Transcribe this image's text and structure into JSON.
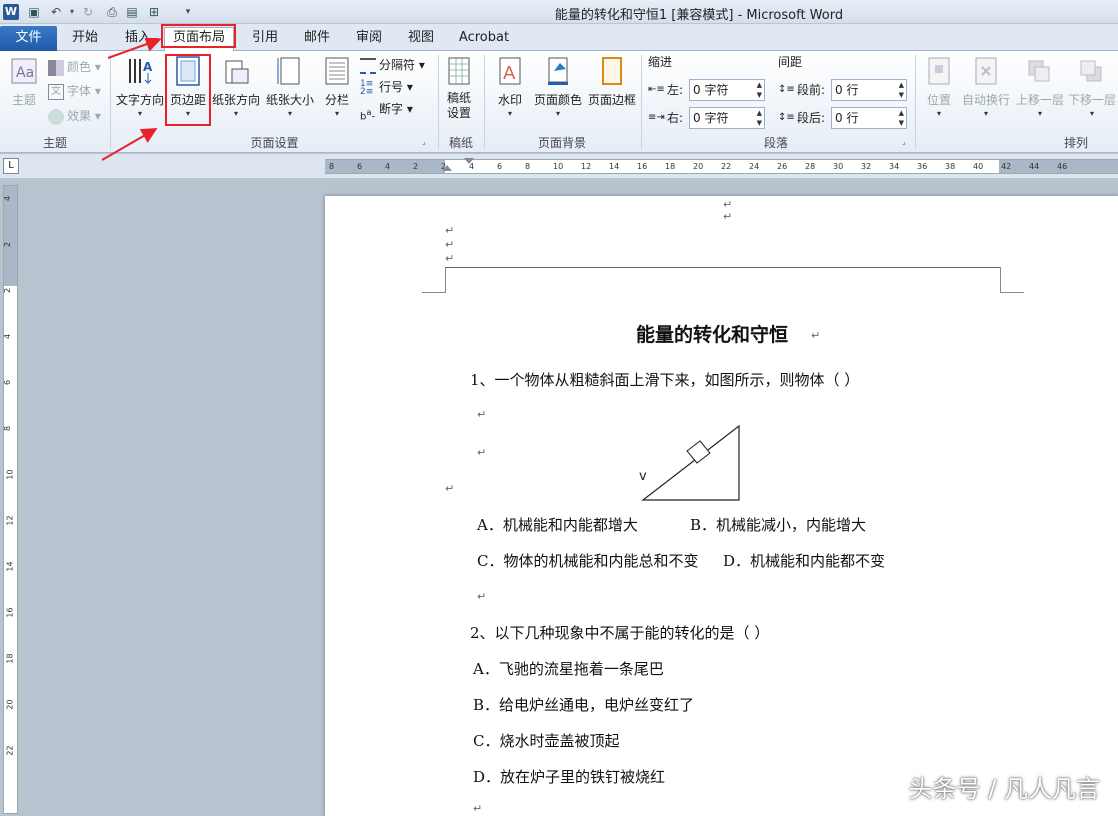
{
  "title_bar": {
    "title": "能量的转化和守恒1 [兼容模式]  -  Microsoft Word"
  },
  "tabs": [
    {
      "label": "文件"
    },
    {
      "label": "开始"
    },
    {
      "label": "插入"
    },
    {
      "label": "页面布局"
    },
    {
      "label": "引用"
    },
    {
      "label": "邮件"
    },
    {
      "label": "审阅"
    },
    {
      "label": "视图"
    },
    {
      "label": "Acrobat"
    }
  ],
  "ribbon": {
    "theme": {
      "big": "主题",
      "colors": "颜色",
      "fonts": "字体",
      "effects": "效果",
      "group": "主题"
    },
    "page_setup": {
      "text_direction": "文字方向",
      "margins": "页边距",
      "orientation": "纸张方向",
      "size": "纸张大小",
      "columns": "分栏",
      "breaks": "分隔符",
      "line_numbers": "行号",
      "hyphenation": "断字",
      "group": "页面设置"
    },
    "draft": {
      "btn": "稿纸\n设置",
      "group": "稿纸"
    },
    "background": {
      "watermark": "水印",
      "page_color": "页面颜色",
      "page_borders": "页面边框",
      "group": "页面背景"
    },
    "paragraph": {
      "indent": "缩进",
      "left": "左:",
      "right": "右:",
      "left_val": "0 字符",
      "right_val": "0 字符",
      "spacing": "间距",
      "before": "段前:",
      "after": "段后:",
      "before_val": "0 行",
      "after_val": "0 行",
      "group": "段落"
    },
    "arrange": {
      "position": "位置",
      "wrap": "自动换行",
      "bring_forward": "上移一层",
      "send_backward": "下移一层",
      "group": "排列"
    }
  },
  "ruler_ticks": [
    "8",
    "6",
    "4",
    "2",
    "2",
    "4",
    "6",
    "8",
    "10",
    "12",
    "14",
    "16",
    "18",
    "20",
    "22",
    "24",
    "26",
    "28",
    "30",
    "32",
    "34",
    "36",
    "38",
    "40",
    "42",
    "44",
    "46"
  ],
  "vruler_ticks": [
    "4",
    "2",
    "2",
    "4",
    "6",
    "8",
    "10",
    "12",
    "14",
    "16",
    "18",
    "20",
    "22"
  ],
  "document": {
    "title": "能量的转化和守恒",
    "q1": "1、一个物体从粗糙斜面上滑下来，如图所示，则物体（   ）",
    "fig_label": "v",
    "q1_a": "A．机械能和内能都增大",
    "q1_b": "B．机械能减小，内能增大",
    "q1_c": "C．物体的机械能和内能总和不变",
    "q1_d": "D．机械能和内能都不变",
    "q2": "2、以下几种现象中不属于能的转化的是（   ）",
    "q2_a": "A．飞驰的流星拖着一条尾巴",
    "q2_b": "B．给电炉丝通电，电炉丝变红了",
    "q2_c": "C．烧水时壶盖被顶起",
    "q2_d": "D．放在炉子里的铁钉被烧红",
    "para_mark": "↵"
  },
  "watermark": "头条号 / 凡人凡言",
  "colors": {
    "accent": "#2b5797",
    "highlight": "#e8222a",
    "ribbon_bg": "#e6edf6"
  }
}
